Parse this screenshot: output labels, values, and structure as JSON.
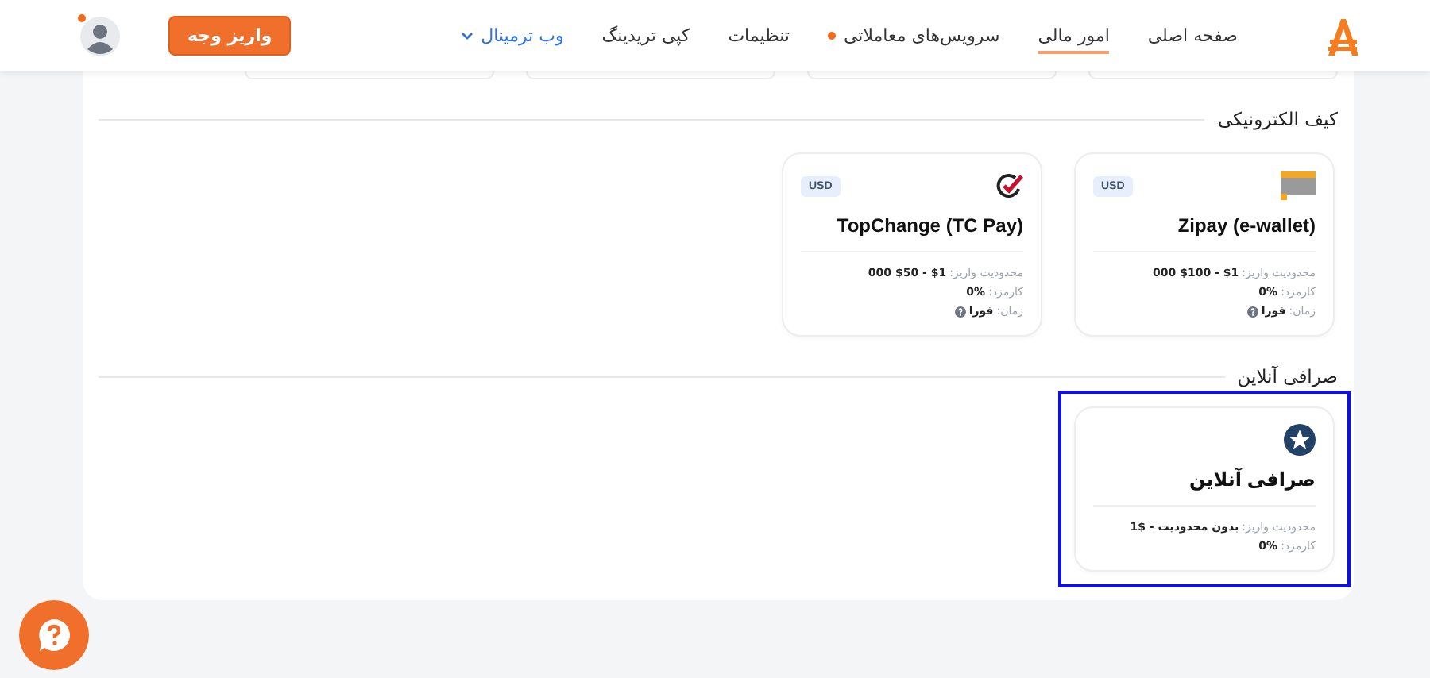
{
  "header": {
    "nav": [
      {
        "label": "صفحه اصلی",
        "selected": false,
        "kind": "link"
      },
      {
        "label": "امور مالی",
        "selected": true,
        "kind": "link"
      },
      {
        "label": "سرویس‌های معاملاتی",
        "selected": false,
        "kind": "link",
        "dot": true
      },
      {
        "label": "تنظیمات",
        "selected": false,
        "kind": "link"
      },
      {
        "label": "کپی تریدینگ",
        "selected": false,
        "kind": "link"
      },
      {
        "label": "وب ترمینال",
        "selected": false,
        "kind": "dropdown"
      }
    ],
    "deposit_button": "واریز وجه",
    "avatar": {
      "notification": true
    }
  },
  "sections": [
    {
      "title": "کیف الکترونیکی",
      "cards": [
        {
          "name": "Zipay (e-wallet)",
          "currency": "USD",
          "highlighted": false,
          "details": [
            {
              "label": "محدودیت واریز:",
              "value": "$1 - $100 000",
              "info": false
            },
            {
              "label": "کارمزد:",
              "value": "0%",
              "info": false
            },
            {
              "label": "زمان:",
              "value": "فورا",
              "info": true
            }
          ]
        },
        {
          "name": "TopChange (TC Pay)",
          "currency": "USD",
          "highlighted": false,
          "details": [
            {
              "label": "محدودیت واریز:",
              "value": "$1 - $50 000",
              "info": false
            },
            {
              "label": "کارمزد:",
              "value": "0%",
              "info": false
            },
            {
              "label": "زمان:",
              "value": "فورا",
              "info": true
            }
          ]
        }
      ]
    },
    {
      "title": "صرافی آنلاین",
      "cards": [
        {
          "name": "صرافی آنلاین",
          "highlighted": true,
          "details": [
            {
              "label": "محدودیت واریز:",
              "value": "بدون محدودیت - $1",
              "info": false
            },
            {
              "label": "کارمزد:",
              "value": "0%",
              "info": false
            }
          ]
        }
      ]
    }
  ]
}
